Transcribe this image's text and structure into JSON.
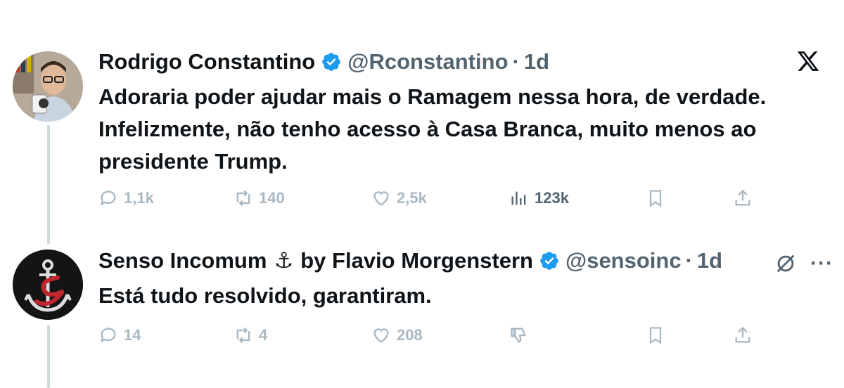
{
  "tweet1": {
    "name": "Rodrigo Constantino",
    "handle": "@Rconstantino",
    "separator": "·",
    "time": "1d",
    "text_line1": "Adoraria poder ajudar mais o Ramagem nessa hora, de verdade.",
    "text_line2": "Infelizmente, não tenho acesso à Casa Branca, muito menos ao",
    "text_line3": "presidente Trump.",
    "replies": "1,1k",
    "retweets": "140",
    "likes": "2,5k",
    "views": "123k",
    "avatar_icon": "person-avatar",
    "verified_icon": "verified-badge-icon"
  },
  "tweet2": {
    "name_part1": "Senso Incomum",
    "emoji": "⚓",
    "name_part2": "by Flavio Morgenstern",
    "handle": "@sensoinc",
    "separator": "·",
    "time": "1d",
    "text": "Está tudo resolvido, garantiram.",
    "replies": "14",
    "retweets": "4",
    "likes": "208",
    "more": "···",
    "avatar_icon": "anchor-logo-avatar",
    "verified_icon": "verified-badge-icon"
  },
  "colors": {
    "verified": "#1d9bf0",
    "muted": "#536471",
    "faded": "#aab8c2",
    "thread_line": "#cfd9de"
  }
}
